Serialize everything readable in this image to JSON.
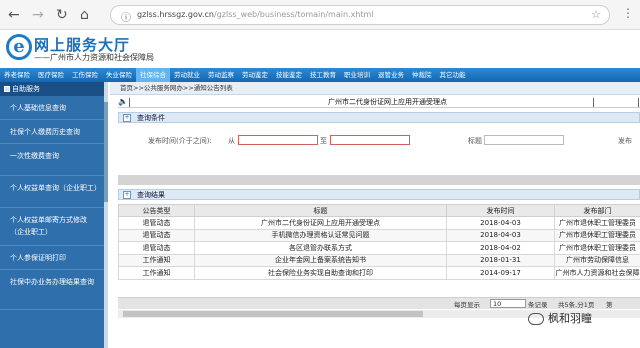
{
  "browser": {
    "url_host": "gzlss.hrssgz.gov.cn",
    "url_path": "/gzlss_web/business/tomain/main.xhtml"
  },
  "site": {
    "logo_letter": "e",
    "title": "网上服务大厅",
    "subtitle": "——广州市人力资源和社会保障局"
  },
  "nav": {
    "items": [
      "养老保险",
      "医疗保险",
      "工伤保险",
      "失业保险",
      "社保综合",
      "劳动就业",
      "劳动监察",
      "劳动鉴定",
      "技能鉴定",
      "技工教育",
      "职业培训",
      "退管业务",
      "仲裁院",
      "其它功能"
    ],
    "active_index": 4
  },
  "sidebar": {
    "header": "自助服务",
    "items": [
      "个人基础信息查询",
      "社保个人缴费历史查询",
      "一次性缴费查询",
      "个人权益单查询（企业职工）",
      "个人权益单邮寄方式修改（企业职工）",
      "个人参保证明打印",
      "社保中办业务办理结果查询"
    ]
  },
  "content": {
    "breadcrumb": "首页>>公共服务网办>>通知公告列表",
    "notice": "广州市二代身份证网上应用开通受理点"
  },
  "query": {
    "section_title": "查询条件",
    "date_label": "发布时间(介于之间):",
    "from_label": "从",
    "to_label": "至",
    "title_label": "标题",
    "dept_label": "发布"
  },
  "results": {
    "section_title": "查询结果",
    "columns": [
      "公告类型",
      "标题",
      "发布时间",
      "发布部门"
    ],
    "rows": [
      [
        "退管动态",
        "广州市二代身份证网上应用开通受理点",
        "2018-04-03",
        "广州市退休职工管理委员"
      ],
      [
        "退管动态",
        "手机微信办理资格认证常见问题",
        "2018-04-03",
        "广州市退休职工管理委员"
      ],
      [
        "退管动态",
        "各区退管办联系方式",
        "2018-04-02",
        "广州市退休职工管理委员"
      ],
      [
        "工作通知",
        "企业年金网上备案系统告知书",
        "2018-01-31",
        "广州市劳动保障信息"
      ],
      [
        "工作通知",
        "社会保险业务实现自助查询和打印",
        "2014-09-17",
        "广州市人力资源和社会保障"
      ]
    ]
  },
  "pager": {
    "show_label": "每页显示",
    "page_size": "10",
    "records": "条记录",
    "summary": "共5条,分1页",
    "current_label": "第"
  },
  "watermark": "枫和羽瞳"
}
